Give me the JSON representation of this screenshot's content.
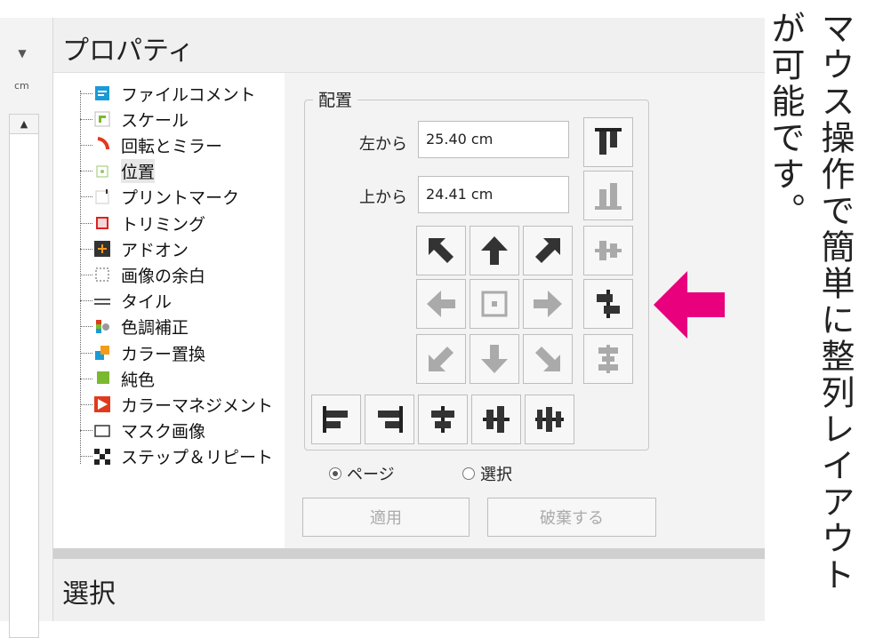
{
  "panel": {
    "title": "プロパティ",
    "unit": "cm",
    "bottom_title": "選択"
  },
  "tree": [
    {
      "label": "ファイルコメント",
      "icon": "file-comment-icon"
    },
    {
      "label": "スケール",
      "icon": "scale-icon"
    },
    {
      "label": "回転とミラー",
      "icon": "rotate-mirror-icon"
    },
    {
      "label": "位置",
      "icon": "position-icon",
      "selected": true
    },
    {
      "label": "プリントマーク",
      "icon": "print-mark-icon"
    },
    {
      "label": "トリミング",
      "icon": "trimming-icon"
    },
    {
      "label": "アドオン",
      "icon": "addon-icon"
    },
    {
      "label": "画像の余白",
      "icon": "image-margin-icon"
    },
    {
      "label": "タイル",
      "icon": "tile-icon"
    },
    {
      "label": "色調補正",
      "icon": "color-correction-icon"
    },
    {
      "label": "カラー置換",
      "icon": "color-replace-icon"
    },
    {
      "label": "純色",
      "icon": "solid-color-icon"
    },
    {
      "label": "カラーマネジメント",
      "icon": "color-management-icon"
    },
    {
      "label": "マスク画像",
      "icon": "mask-image-icon"
    },
    {
      "label": "ステップ＆リピート",
      "icon": "step-repeat-icon"
    }
  ],
  "align": {
    "group_title": "配置",
    "left_label": "左から",
    "left_value": "25.40 cm",
    "top_label": "上から",
    "top_value": "24.41 cm",
    "radio_page": "ページ",
    "radio_selection": "選択",
    "apply": "適用",
    "discard": "破棄する"
  },
  "caption": {
    "col1": "マウス操作で簡単に整列レイアウト",
    "col2": "が可能です。"
  },
  "colors": {
    "accent_pink": "#e8007d"
  }
}
